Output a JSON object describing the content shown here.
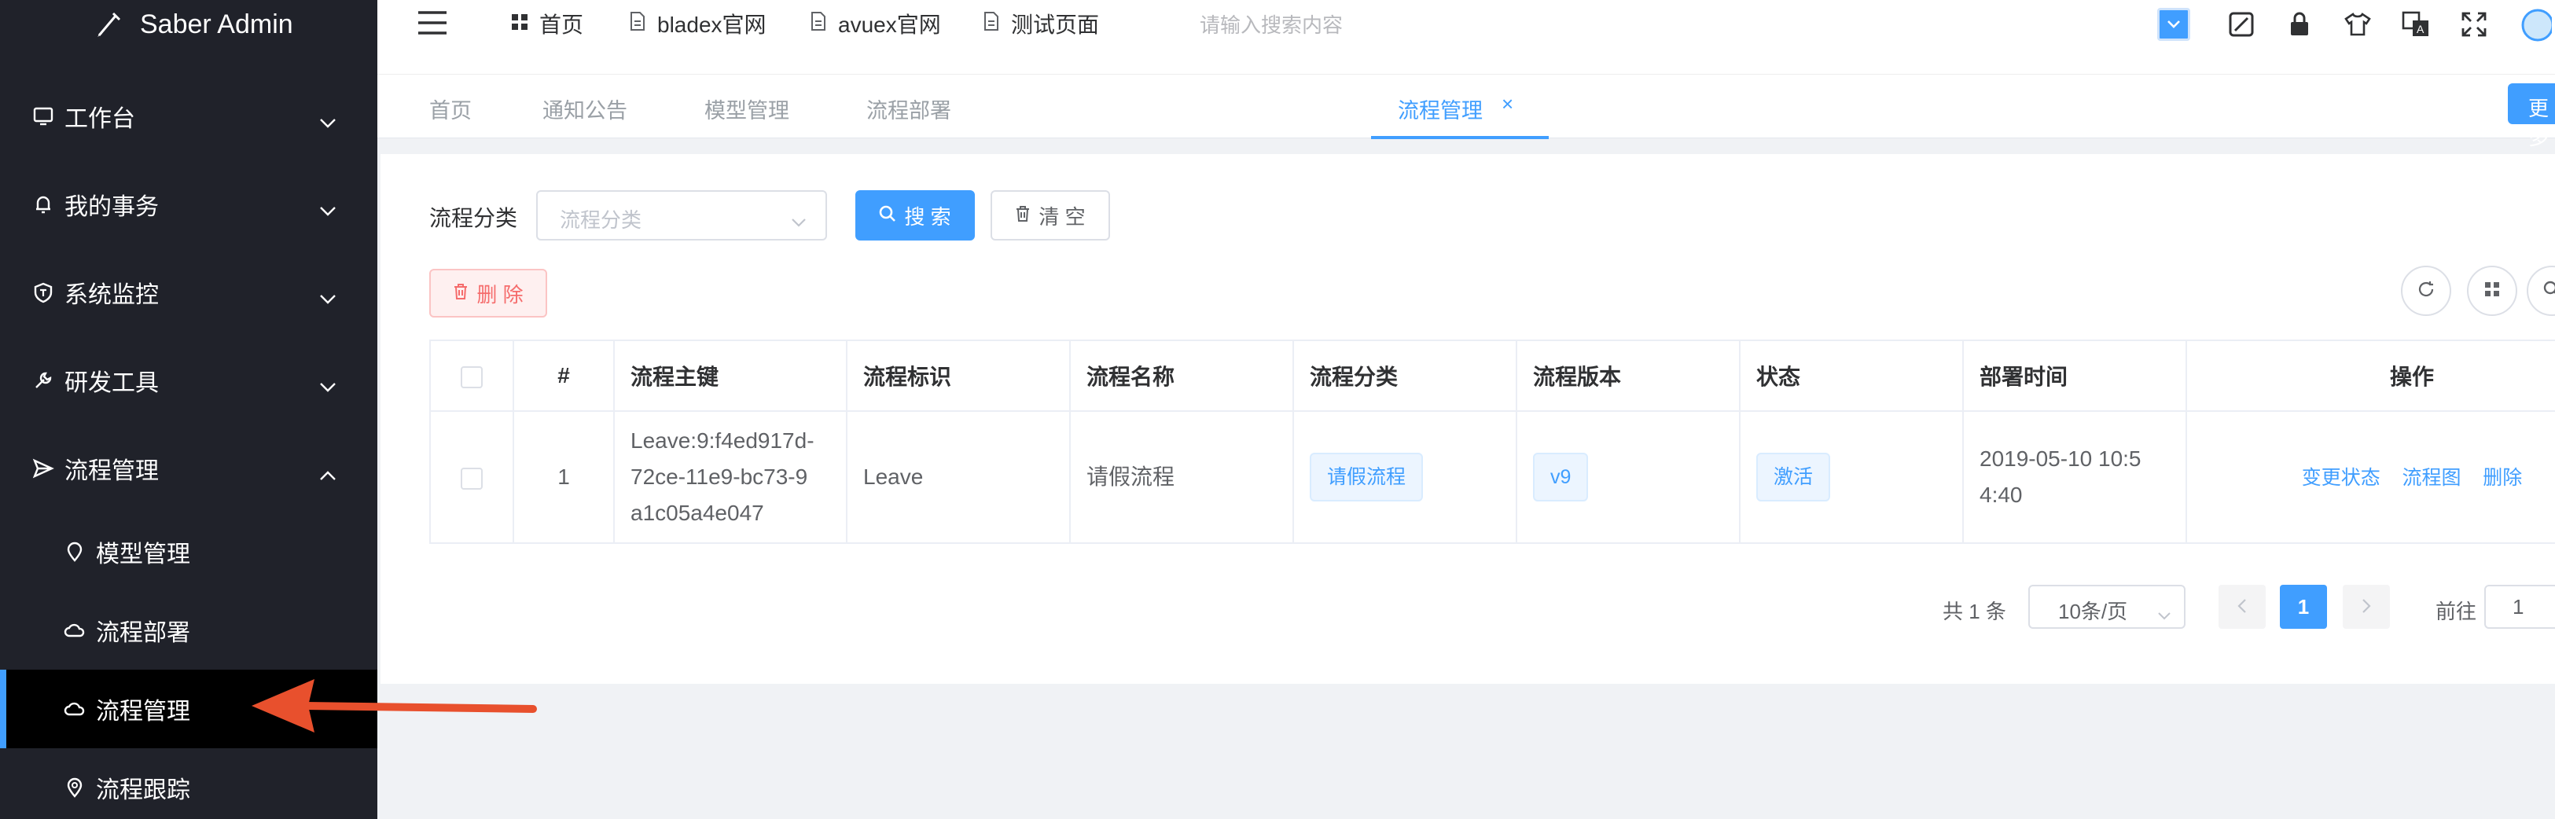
{
  "sidebar": {
    "brand": "Saber Admin",
    "menu": [
      {
        "label": "工作台"
      },
      {
        "label": "我的事务"
      },
      {
        "label": "系统监控"
      },
      {
        "label": "研发工具"
      },
      {
        "label": "流程管理"
      }
    ],
    "submenu": [
      {
        "label": "模型管理"
      },
      {
        "label": "流程部署"
      },
      {
        "label": "流程管理"
      },
      {
        "label": "流程跟踪"
      }
    ]
  },
  "header": {
    "nav": [
      {
        "label": "首页",
        "icon": "grid-icon"
      },
      {
        "label": "bladex官网",
        "icon": "document-icon"
      },
      {
        "label": "avuex官网",
        "icon": "document-icon"
      },
      {
        "label": "测试页面",
        "icon": "document-icon"
      }
    ],
    "search_placeholder": "请输入搜索内容",
    "tools": [
      "dropdown-icon",
      "lock-screen-icon",
      "lock-icon",
      "theme-shirt-icon",
      "language-icon",
      "fullscreen-icon",
      "avatar"
    ]
  },
  "tabs": {
    "items": [
      {
        "label": "首页"
      },
      {
        "label": "通知公告"
      },
      {
        "label": "模型管理"
      },
      {
        "label": "流程部署"
      },
      {
        "label": "流程管理",
        "active": true,
        "close": "×"
      }
    ],
    "more_label": "更多"
  },
  "filter": {
    "label": "流程分类",
    "select_placeholder": "流程分类",
    "search_label": "搜 索",
    "clear_label": "清 空",
    "delete_label": "删 除"
  },
  "table": {
    "headers": [
      "#",
      "流程主键",
      "流程标识",
      "流程名称",
      "流程分类",
      "流程版本",
      "状态",
      "部署时间",
      "操作"
    ],
    "rows": [
      {
        "index": "1",
        "key": "Leave:9:f4ed917d-72ce-11e9-bc73-9a1c05a4e047",
        "key_lines": [
          "Leave:9:f4ed917d-",
          "72ce-11e9-bc73-9",
          "a1c05a4e047"
        ],
        "identifier": "Leave",
        "name": "请假流程",
        "category": "请假流程",
        "version": "v9",
        "status": "激活",
        "deploy_time_lines": [
          "2019-05-10 10:5",
          "4:40"
        ],
        "actions": [
          "变更状态",
          "流程图",
          "删除"
        ]
      }
    ]
  },
  "pagination": {
    "total": "共 1 条",
    "page_size": "10条/页",
    "prev": "<",
    "current_page": "1",
    "next": ">",
    "goto_label": "前往",
    "goto_value": "1"
  },
  "colors": {
    "sidebar_bg": "#20222a",
    "active_item_bg": "#000000",
    "primary": "#409eff",
    "danger": "#f56c6c",
    "annotation_arrow": "#e8502d"
  }
}
